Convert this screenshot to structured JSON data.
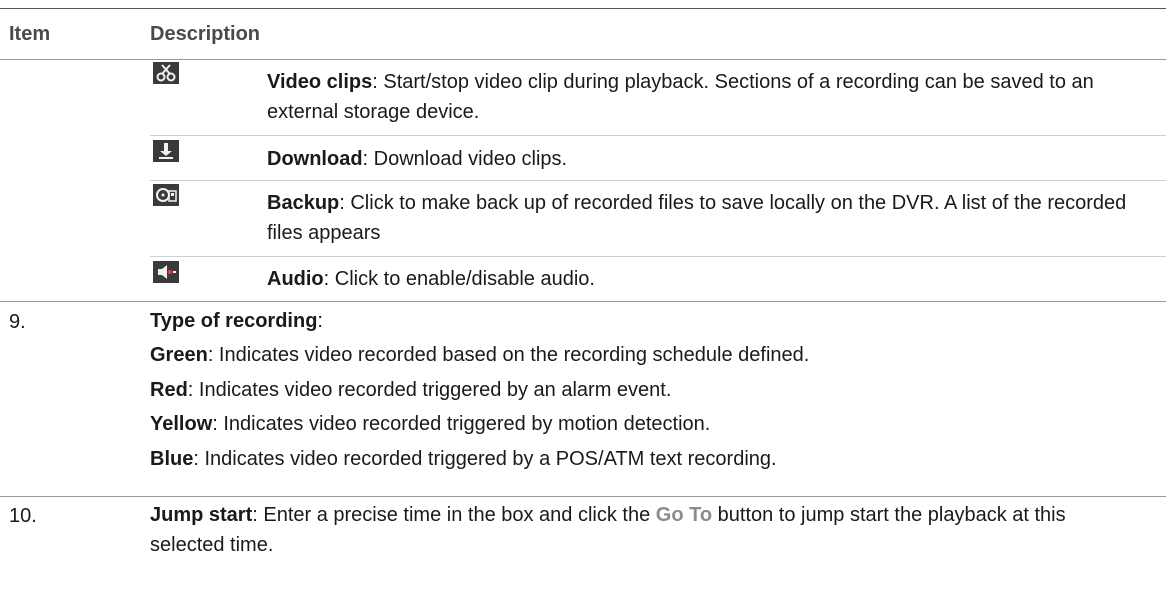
{
  "table": {
    "header": {
      "item": "Item",
      "description": "Description"
    },
    "icon_rows": [
      {
        "icon": "scissors-icon",
        "term": "Video clips",
        "text": ": Start/stop video clip during playback. Sections of a recording can be saved to an external storage device."
      },
      {
        "icon": "download-icon",
        "term": "Download",
        "text": ": Download video clips."
      },
      {
        "icon": "backup-icon",
        "term": "Backup",
        "text": ": Click to make back up of recorded files to save locally on the DVR. A list of the recorded files appears"
      },
      {
        "icon": "audio-icon",
        "term": "Audio",
        "text": ": Click to enable/disable audio."
      }
    ],
    "item9": {
      "number": "9.",
      "title": "Type of recording",
      "title_suffix": ":",
      "lines": [
        {
          "term": "Green",
          "text": ": Indicates video recorded based on the recording schedule defined."
        },
        {
          "term": "Red",
          "text": ": Indicates video recorded triggered by an alarm event."
        },
        {
          "term": "Yellow",
          "text": ": Indicates video recorded triggered by motion detection."
        },
        {
          "term": "Blue",
          "text": ": Indicates video recorded triggered by a POS/ATM text recording."
        }
      ]
    },
    "item10": {
      "number": "10.",
      "term": "Jump start",
      "text_before": ": Enter a precise time in the box and click the ",
      "button_name": "Go To",
      "text_after": " button to jump start the playback at this selected time."
    }
  }
}
